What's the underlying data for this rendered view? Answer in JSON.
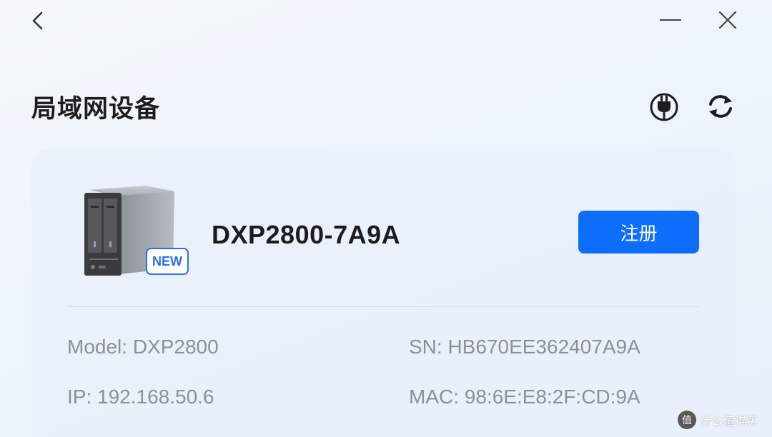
{
  "header": {
    "title": "局域网设备"
  },
  "icons": {
    "back": "chevron-left-icon",
    "minimize": "minimize-icon",
    "close": "close-icon",
    "plug": "plug-icon",
    "refresh": "refresh-icon"
  },
  "device": {
    "name": "DXP2800-7A9A",
    "badge": "NEW",
    "register_label": "注册",
    "model": "Model: DXP2800",
    "sn": "SN: HB670EE362407A9A",
    "ip": "IP: 192.168.50.6",
    "mac": "MAC: 98:6E:E8:2F:CD:9A"
  },
  "watermark": {
    "text": "什么值得买"
  },
  "colors": {
    "accent": "#0d6efd",
    "badge": "#2a6df4",
    "card_bg": "#e9f0fa",
    "muted_text": "#8c9099"
  }
}
